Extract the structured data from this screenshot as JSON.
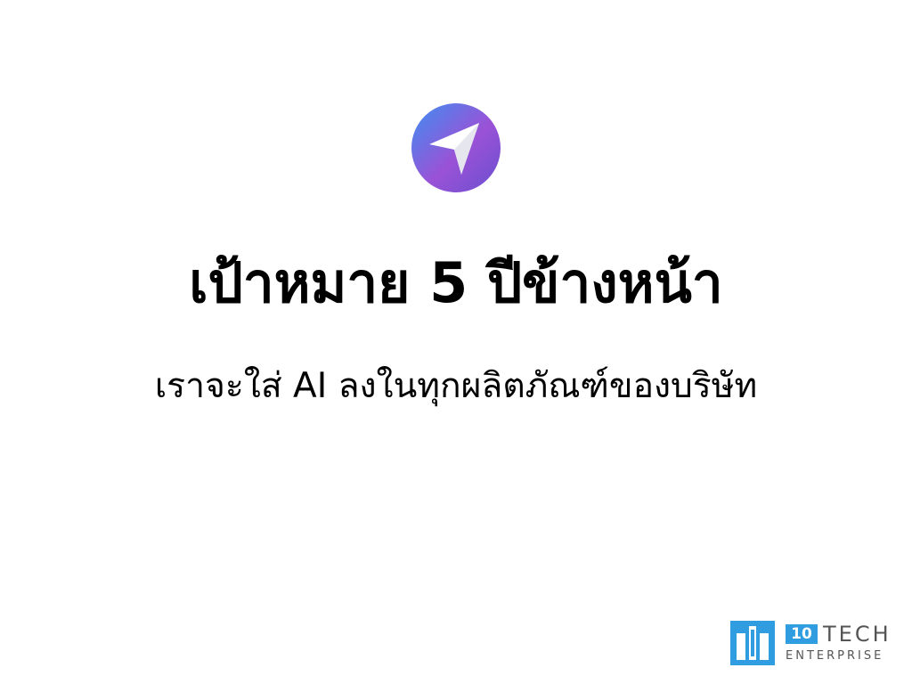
{
  "slide": {
    "icon": "send-arrow-icon",
    "title": "เป้าหมาย 5 ปีข้างหน้า",
    "subtitle": "เราจะใส่ AI ลงในทุกผลิตภัณฑ์ของบริษัท"
  },
  "brand": {
    "mark_icon": "iotech-logo-mark-icon",
    "badge": "10",
    "name": "TECH",
    "tagline": "ENTERPRISE"
  },
  "colors": {
    "icon_gradient_start": "#3d8ff2",
    "icon_gradient_mid": "#9a52d6",
    "icon_gradient_end": "#6a4fd0",
    "brand_blue": "#2f9de0",
    "brand_text": "#555555",
    "text": "#000000",
    "background": "#ffffff"
  }
}
